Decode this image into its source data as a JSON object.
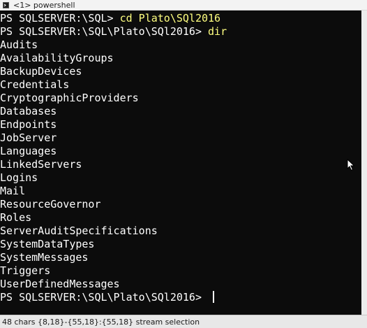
{
  "tab": {
    "label": "<1> powershell",
    "icon": "terminal-icon"
  },
  "terminal": {
    "background": "#0c0c0c",
    "text_color": "#ffffff",
    "command_color": "#ffff80",
    "lines": [
      {
        "prompt": "PS SQLSERVER:\\SQL> ",
        "command": "cd Plato\\SQl2016"
      },
      {
        "prompt": "PS SQLSERVER:\\SQL\\Plato\\SQl2016> ",
        "command": "dir"
      },
      {
        "text": "Audits"
      },
      {
        "text": "AvailabilityGroups"
      },
      {
        "text": "BackupDevices"
      },
      {
        "text": "Credentials"
      },
      {
        "text": "CryptographicProviders"
      },
      {
        "text": "Databases"
      },
      {
        "text": "Endpoints"
      },
      {
        "text": "JobServer"
      },
      {
        "text": "Languages"
      },
      {
        "text": "LinkedServers"
      },
      {
        "text": "Logins"
      },
      {
        "text": "Mail"
      },
      {
        "text": "ResourceGovernor"
      },
      {
        "text": "Roles"
      },
      {
        "text": "ServerAuditSpecifications"
      },
      {
        "text": "SystemDataTypes"
      },
      {
        "text": "SystemMessages"
      },
      {
        "text": "Triggers"
      },
      {
        "text": "UserDefinedMessages"
      },
      {
        "prompt": "PS SQLSERVER:\\SQL\\Plato\\SQl2016> ",
        "command": "",
        "cursor": true
      }
    ]
  },
  "statusbar": {
    "text": "48 chars {8,18}-{55,18}:{55,18} stream selection"
  },
  "mouse_pointer": {
    "icon": "mouse-pointer-icon"
  }
}
